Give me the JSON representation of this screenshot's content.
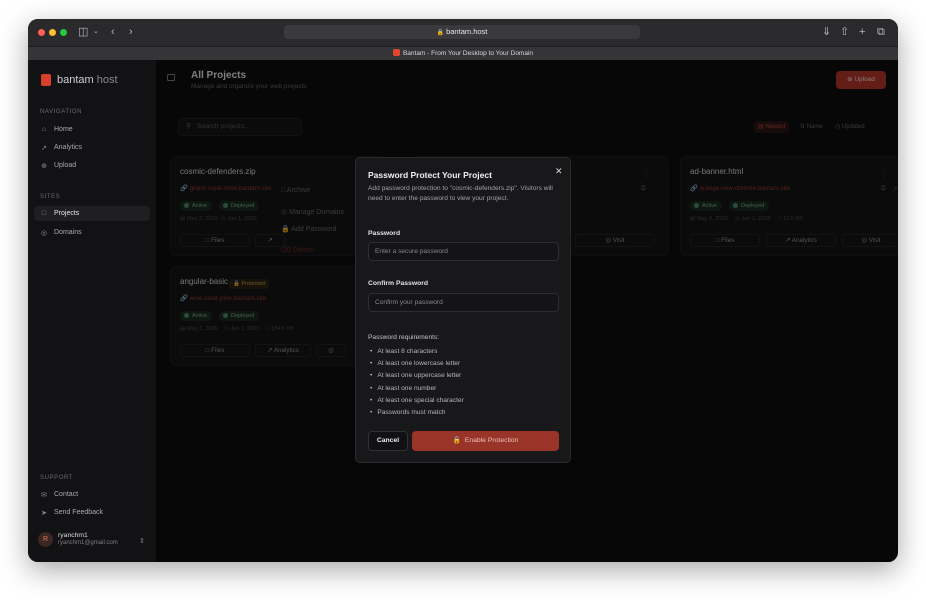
{
  "browser": {
    "url": "bantam.host",
    "tab_title": "Bantam - From Your Desktop to Your Domain"
  },
  "sidebar": {
    "brand_main": "bantam",
    "brand_host": "host",
    "nav_section": "NAVIGATION",
    "nav_items": [
      {
        "label": "Home",
        "icon": "home-icon"
      },
      {
        "label": "Analytics",
        "icon": "analytics-icon"
      },
      {
        "label": "Upload",
        "icon": "upload-icon"
      }
    ],
    "sites_section": "SITES",
    "site_items": [
      {
        "label": "Projects",
        "icon": "folder-icon",
        "active": true
      },
      {
        "label": "Domains",
        "icon": "globe-icon"
      }
    ],
    "support_section": "SUPPORT",
    "support_items": [
      {
        "label": "Contact",
        "icon": "mail-icon"
      },
      {
        "label": "Send Feedback",
        "icon": "send-icon"
      }
    ],
    "user": {
      "initial": "R",
      "name": "ryanchm1",
      "email": "ryanchm1@gmail.com"
    }
  },
  "header": {
    "title": "All Projects",
    "subtitle": "Manage and organize your web projects",
    "upload_label": "Upload"
  },
  "toolbar": {
    "search_placeholder": "Search projects...",
    "sort_newest": "Newest",
    "sort_name": "Name",
    "sort_updated": "Updated"
  },
  "projects": [
    {
      "name": "cosmic-defenders.zip",
      "url": "grand-royal-shoe.bantam.site",
      "status": "Active",
      "deploy": "Deployed",
      "created": "May 2, 2025",
      "updated": "Jun 1, 2025",
      "size": "",
      "files": "Files",
      "analytics": "Analytics",
      "visit": "Visit"
    },
    {
      "name": "ad-banner.html",
      "url": "orange-new-chrome.bantam.site",
      "status": "Active",
      "deploy": "Deployed",
      "created": "May 2, 2025",
      "updated": "Jun 1, 2025",
      "size": "12.6 KB",
      "files": "Files",
      "analytics": "Analytics",
      "visit": "Visit"
    },
    {
      "name": "angular-basic",
      "protected": "Protected",
      "url": "wise-clear-pine.bantam.site",
      "status": "Active",
      "deploy": "Deployed",
      "created": "May 1, 2025",
      "updated": "Jun 1, 2025",
      "size": "134.6 KB",
      "files": "Files",
      "analytics": "Analytics"
    }
  ],
  "context_menu": [
    "Archive",
    "Manage Domains",
    "Add Password",
    "Delete"
  ],
  "modal": {
    "title": "Password Protect Your Project",
    "description": "Add password protection to \"cosmic-defenders.zip\". Visitors will need to enter the password to view your project.",
    "password_label": "Password",
    "password_placeholder": "Enter a secure password",
    "confirm_label": "Confirm Password",
    "confirm_placeholder": "Confirm your password",
    "requirements_title": "Password requirements:",
    "requirements": [
      "At least 8 characters",
      "At least one lowercase letter",
      "At least one uppercase letter",
      "At least one number",
      "At least one special character",
      "Passwords must match"
    ],
    "cancel_label": "Cancel",
    "enable_label": "Enable Protection"
  },
  "colors": {
    "accent": "#b5382a",
    "active_badge": "#4e8d66",
    "protected_badge": "#c9a44c"
  }
}
